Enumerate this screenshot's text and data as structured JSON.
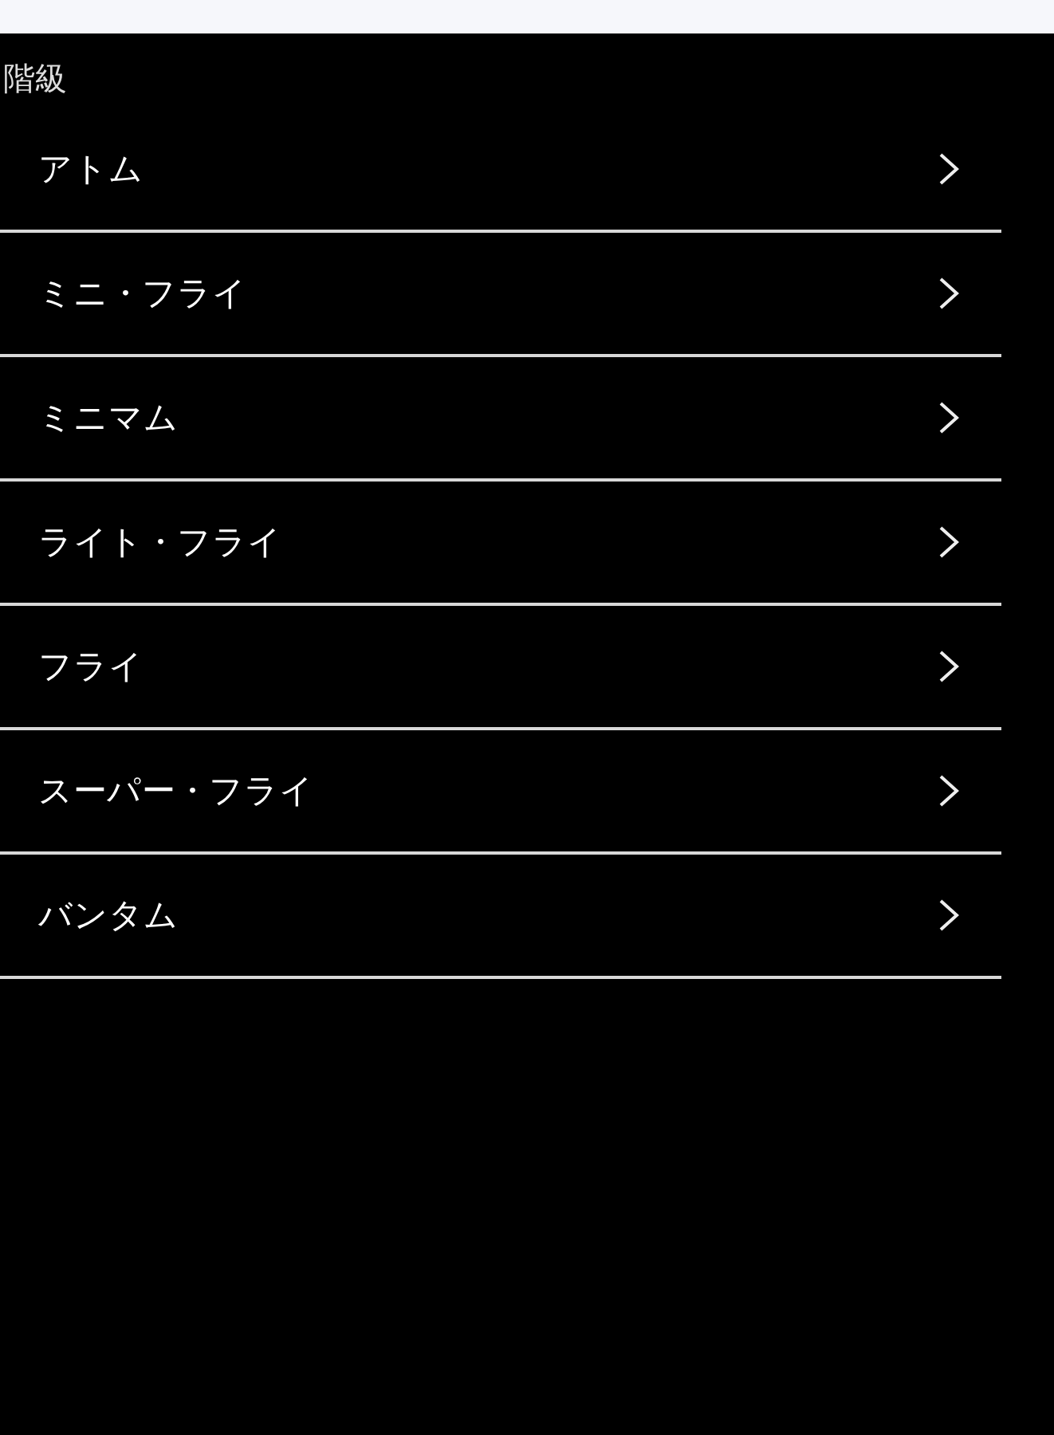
{
  "section": {
    "title": "階級"
  },
  "items": [
    {
      "label": "アトム"
    },
    {
      "label": "ミニ・フライ"
    },
    {
      "label": "ミニマム"
    },
    {
      "label": "ライト・フライ"
    },
    {
      "label": "フライ"
    },
    {
      "label": "スーパー・フライ"
    },
    {
      "label": "バンタム"
    }
  ]
}
